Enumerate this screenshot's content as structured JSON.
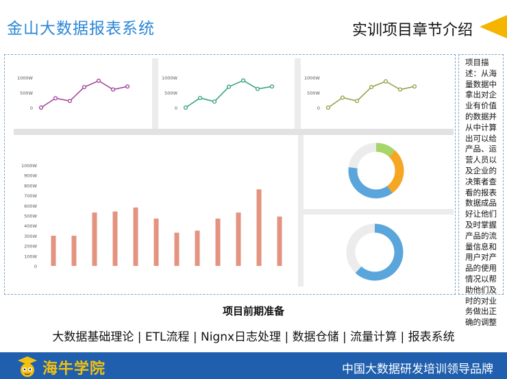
{
  "header": {
    "title": "金山大数据报表系统",
    "section_title": "实训项目章节介绍"
  },
  "description": {
    "text": "项目描述：从海量数据中拿出对企业有价值的数据并从中计算出可以给产品、运营人员以及企业的决策者查看的报表数据成品好让他们及时掌握产品的流量信息和用户对产品的使用情况以帮助他们及时的对业务做出正确的调整"
  },
  "caption": "项目前期准备",
  "topics": "大数据基础理论 |  ETL流程 | Nignx日志处理 | 数据仓储 | 流量计算 | 报表系统",
  "footer": {
    "logo_text": "海牛学院",
    "slogan": "中国大数据研发培训领导品牌"
  },
  "colors": {
    "title_blue": "#2a86d6",
    "accent_yellow": "#f4b400",
    "footer_blue": "#1f5fae",
    "line1": "#a4449e",
    "line2": "#3aa57c",
    "line3": "#97a04b",
    "bar": "#e3937f",
    "donut_green": "#a6d66a",
    "donut_orange": "#f5a623",
    "donut_blue": "#5aa5dc",
    "donut_track": "#ececec"
  },
  "chart_data": [
    {
      "type": "line",
      "yticks": [
        "1000W",
        "500W",
        "0"
      ],
      "ylim": [
        0,
        1000
      ],
      "values": [
        0,
        310,
        220,
        680,
        890,
        600,
        700
      ],
      "color": "#a4449e"
    },
    {
      "type": "line",
      "yticks": [
        "1000W",
        "500W",
        "0"
      ],
      "ylim": [
        0,
        1000
      ],
      "values": [
        0,
        320,
        200,
        690,
        900,
        620,
        700
      ],
      "color": "#3aa57c"
    },
    {
      "type": "line",
      "yticks": [
        "1000W",
        "500W",
        "0"
      ],
      "ylim": [
        0,
        1000
      ],
      "values": [
        0,
        330,
        220,
        680,
        870,
        600,
        700
      ],
      "color": "#97a04b"
    },
    {
      "type": "bar",
      "yticks": [
        "1000W",
        "900W",
        "800W",
        "700W",
        "600W",
        "500W",
        "400W",
        "300W",
        "200W",
        "100W",
        "0"
      ],
      "ylim": [
        0,
        1000
      ],
      "values": [
        300,
        300,
        530,
        540,
        580,
        470,
        330,
        350,
        470,
        530,
        760,
        490
      ],
      "color": "#e3937f"
    },
    {
      "type": "pie",
      "slices": [
        {
          "value": 12,
          "color": "#a6d66a"
        },
        {
          "value": 28,
          "color": "#f5a623"
        },
        {
          "value": 37,
          "color": "#5aa5dc"
        },
        {
          "value": 23,
          "color": "#ececec"
        }
      ]
    },
    {
      "type": "pie",
      "slices": [
        {
          "value": 62,
          "color": "#5aa5dc"
        },
        {
          "value": 38,
          "color": "#ececec"
        }
      ]
    }
  ]
}
